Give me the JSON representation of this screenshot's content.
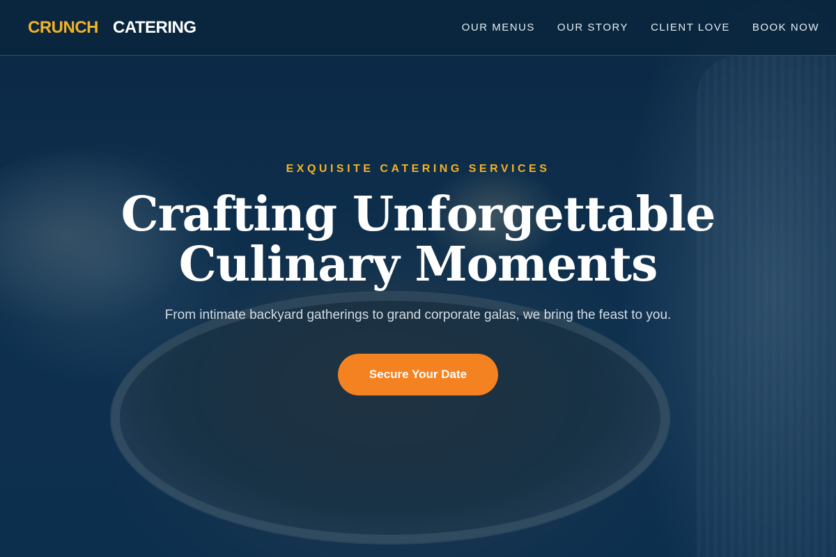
{
  "brand": {
    "name_part1": "CRUNCH",
    "name_part2": "CATERING",
    "accent_color": "#f5b323"
  },
  "nav": {
    "items": [
      {
        "label": "OUR MENUS"
      },
      {
        "label": "OUR STORY"
      },
      {
        "label": "CLIENT LOVE"
      },
      {
        "label": "BOOK NOW"
      }
    ]
  },
  "hero": {
    "eyebrow": "EXQUISITE CATERING SERVICES",
    "headline_line1": "Crafting Unforgettable",
    "headline_line2": "Culinary Moments",
    "subheadline": "From intimate backyard gatherings to grand corporate galas, we bring the feast to you.",
    "cta_label": "Secure Your Date",
    "cta_color": "#f58220",
    "overlay_color": "#0d2f4c"
  }
}
